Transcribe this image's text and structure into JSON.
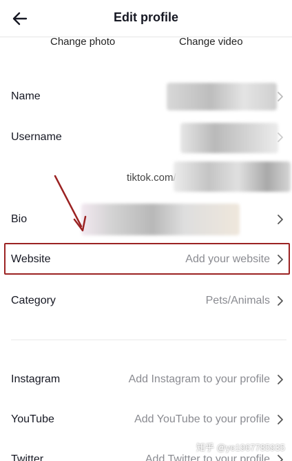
{
  "header": {
    "title": "Edit profile",
    "back_icon": "arrow-left-icon"
  },
  "photo_links": {
    "change_photo": "Change photo",
    "change_video": "Change video"
  },
  "profile_fields": [
    {
      "label": "Name",
      "value": ""
    },
    {
      "label": "Username",
      "value": ""
    },
    {
      "label": "Bio",
      "value": ""
    },
    {
      "label": "Website",
      "value": "Add your website"
    },
    {
      "label": "Category",
      "value": "Pets/Animals"
    }
  ],
  "tiktok_url": "tiktok.com/@",
  "social_links": [
    {
      "label": "Instagram",
      "value": "Add Instagram to your profile"
    },
    {
      "label": "YouTube",
      "value": "Add YouTube to your profile"
    },
    {
      "label": "Twitter",
      "value": "Add Twitter to your profile"
    }
  ],
  "watermark": "知乎 @ye1967785935",
  "colors": {
    "highlight_border": "#9b2222",
    "annotation_arrow": "#9b2222",
    "value_text": "#8a8b91"
  }
}
